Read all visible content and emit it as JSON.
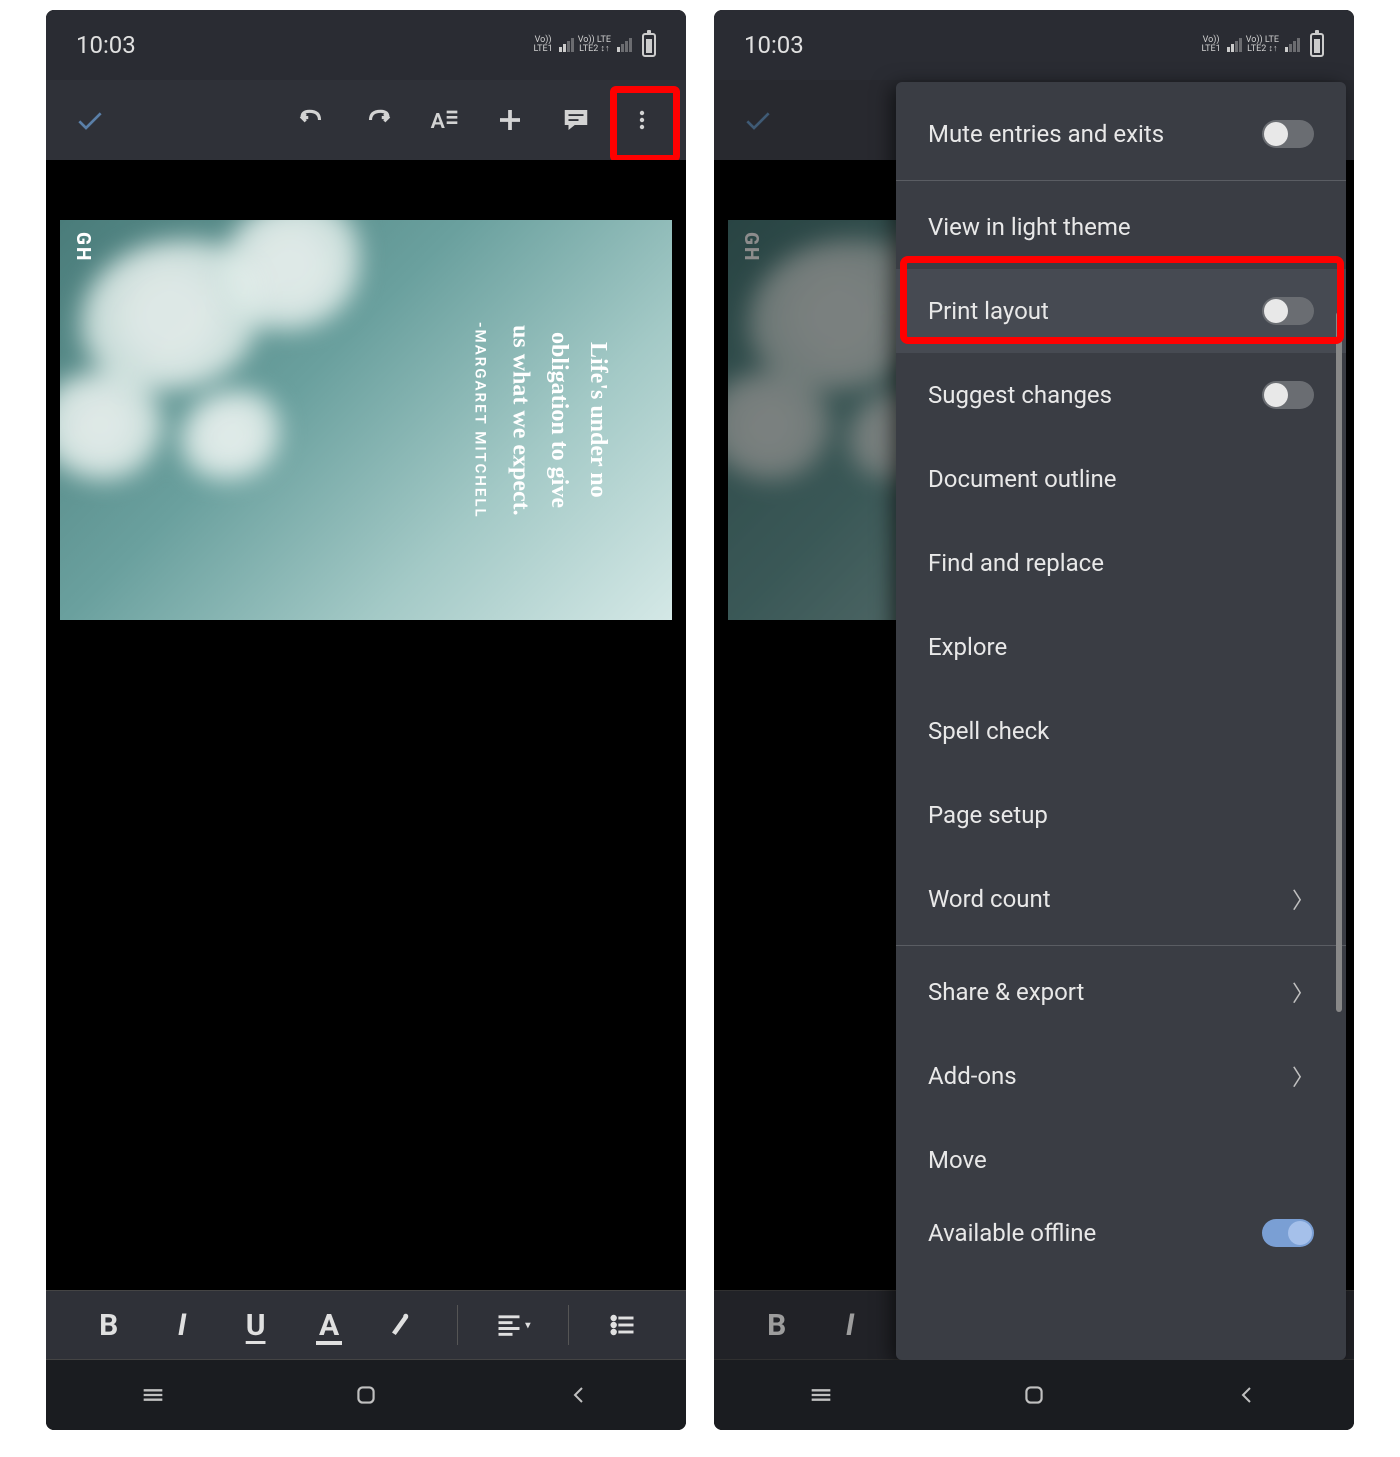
{
  "status": {
    "time": "10:03",
    "sig1_top": "Vo))",
    "sig1_bot": "LTE1",
    "sig2_top": "Vo)) LTE",
    "sig2_bot": "LTE2 ↕↑"
  },
  "doc": {
    "badge": "GH",
    "quote_l1": "Life's under no",
    "quote_l2": "obligation to give",
    "quote_l3": "us what we expect.",
    "author": "-MARGARET MITCHELL"
  },
  "format": {
    "bold": "B",
    "italic": "I",
    "underline": "U",
    "color": "A"
  },
  "menu": {
    "mute": "Mute entries and exits",
    "light": "View in light theme",
    "print": "Print layout",
    "suggest": "Suggest changes",
    "outline": "Document outline",
    "find": "Find and replace",
    "explore": "Explore",
    "spell": "Spell check",
    "page_setup": "Page setup",
    "word_count": "Word count",
    "share": "Share & export",
    "addons": "Add-ons",
    "move": "Move",
    "offline": "Available offline"
  }
}
